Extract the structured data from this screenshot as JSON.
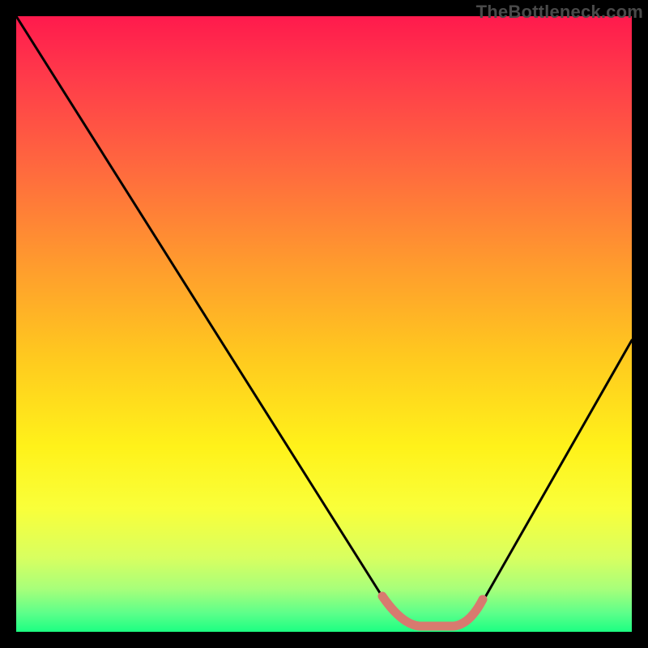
{
  "watermark": "TheBottleneck.com",
  "colors": {
    "frame": "#000000",
    "curve_stroke": "#000000",
    "flat_segment": "#d87a6f",
    "gradient_top": "#ff1a4d",
    "gradient_bottom": "#1cff82"
  },
  "chart_data": {
    "type": "line",
    "title": "",
    "xlabel": "",
    "ylabel": "",
    "xlim": [
      0,
      100
    ],
    "ylim": [
      0,
      100
    ],
    "x": [
      0,
      5,
      10,
      15,
      20,
      25,
      30,
      35,
      40,
      45,
      50,
      55,
      60,
      63,
      66,
      70,
      75,
      80,
      85,
      90,
      95,
      100
    ],
    "values": [
      100,
      92,
      84,
      76.5,
      69,
      61.5,
      53.5,
      46,
      38,
      30,
      22,
      14.5,
      6.5,
      2,
      0.5,
      0.5,
      2,
      8.5,
      17.5,
      27,
      37,
      47
    ],
    "flat_segment_x": [
      60,
      73
    ],
    "annotations": []
  }
}
